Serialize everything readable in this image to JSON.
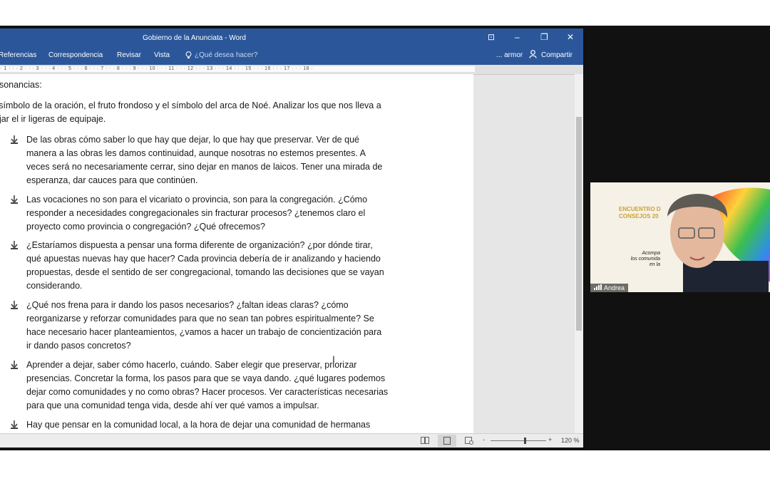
{
  "window": {
    "title": "Gobierno de la Anunciata - Word",
    "controls": {
      "ribbon_display": "⊡",
      "minimize": "–",
      "restore": "❐",
      "close": "✕"
    }
  },
  "ribbon": {
    "tabs": [
      "Referencias",
      "Correspondencia",
      "Revisar",
      "Vista"
    ],
    "tell_me": "¿Qué desea hacer?",
    "user": "... armor",
    "share": "Compartir"
  },
  "ruler": {
    "marks": "· 1 · · · 2 · · · 3 · · · 4 · · · 5 · · · 6 · · · 7 · · · 8 · · · 9 · · · 10 · · · 11 · · · 12 · · · 13 · · · 14 · · · 15 · · · 16 · · · 17 · · · 18 ·"
  },
  "document": {
    "heading": "esonancias:",
    "intro": [
      "l símbolo de la oración, el fruto frondoso y el símbolo del arca de Noé. Analizar los que nos lleva a",
      "ejar el ir ligeras de equipaje."
    ],
    "bullets": [
      [
        "De las obras cómo saber lo que hay que dejar, lo que hay que preservar. Ver de qué",
        "manera a las obras les damos continuidad, aunque nosotras no estemos presentes. A",
        "veces será no necesariamente cerrar, sino dejar en manos de laicos. Tener una mirada de",
        "esperanza, dar cauces para que continúen."
      ],
      [
        "Las vocaciones no son para el vicariato o provincia, son para la congregación. ¿Cómo",
        "responder a necesidades congregacionales sin fracturar procesos? ¿tenemos claro el",
        "proyecto como provincia o congregación? ¿Qué ofrecemos?"
      ],
      [
        "¿Estaríamos dispuesta a pensar una forma diferente de organización? ¿por dónde tirar,",
        "qué apuestas nuevas hay que hacer? Cada provincia debería de ir analizando y haciendo",
        "propuestas, desde el sentido de ser congregacional, tomando las decisiones que se vayan",
        "considerando."
      ],
      [
        "¿Qué nos frena para ir dando los pasos necesarios? ¿faltan ideas claras? ¿cómo",
        "reorganizarse y reforzar comunidades para que no sean tan pobres espiritualmente? Se",
        "hace necesario hacer planteamientos, ¿vamos a hacer un trabajo de concientización para",
        "ir dando pasos concretos?"
      ],
      [
        "Aprender a dejar, saber cómo hacerlo, cuándo. Saber elegir que preservar, priorizar",
        "presencias. Concretar la forma, los pasos para que se vaya dando. ¿qué lugares podemos",
        "dejar como comunidades y no como obras? Hacer procesos. Ver características necesarias",
        "para que una comunidad tenga vida, desde ahí ver qué vamos a impulsar."
      ],
      [
        "Hay que pensar en la comunidad local, a la hora de dejar una comunidad de hermanas"
      ]
    ]
  },
  "statusbar": {
    "zoom_minus": "-",
    "zoom_plus": "+",
    "zoom": "120 %",
    "zoom_level": 0.6
  },
  "video": {
    "participant": "Andrea",
    "background_text": [
      "ENCUENTRO D",
      "CONSEJOS 20"
    ],
    "caption_text": [
      "Acompa",
      "los comunida",
      "en la"
    ]
  },
  "colors": {
    "word_blue": "#2b579a",
    "bullet": "#444444"
  }
}
